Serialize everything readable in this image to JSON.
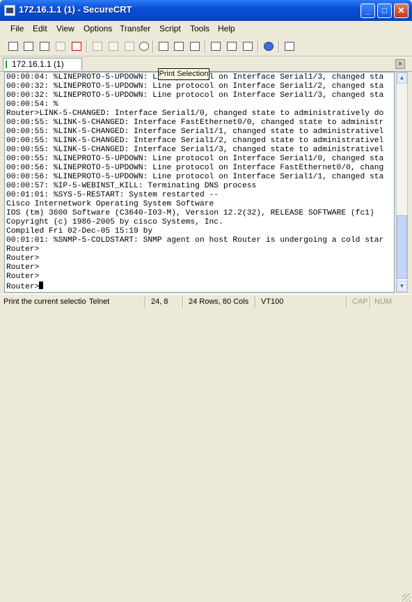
{
  "window": {
    "title": "172.16.1.1 (1) - SecureCRT"
  },
  "menu": [
    "File",
    "Edit",
    "View",
    "Options",
    "Transfer",
    "Script",
    "Tools",
    "Help"
  ],
  "toolbar": {
    "buttons": [
      "connect-icon",
      "quick-connect-icon",
      "connect-in-tab-icon",
      "reconnect-icon",
      "disconnect-icon",
      "copy-icon",
      "paste-icon",
      "copy-paste-icon",
      "find-icon",
      "print-selection-icon",
      "print-setup-icon",
      "print-icon",
      "session-options-icon",
      "global-options-icon",
      "keymap-icon",
      "help-icon",
      "customize-icon"
    ],
    "tooltip": "Print Selection"
  },
  "tab": {
    "label": "172.16.1.1 (1)",
    "close": "×"
  },
  "terminal": {
    "lines": [
      "00:00:04: %LINEPROTO-5-UPDOWN: Line protocol on Interface Serial1/3, changed sta",
      "00:00:32: %LINEPROTO-5-UPDOWN: Line protocol on Interface Serial1/2, changed sta",
      "00:00:32: %LINEPROTO-5-UPDOWN: Line protocol on Interface Serial1/3, changed sta",
      "00:00:54: %",
      "Router>LINK-5-CHANGED: Interface Serial1/0, changed state to administratively do",
      "00:00:55: %LINK-5-CHANGED: Interface FastEthernet0/0, changed state to administr",
      "00:00:55: %LINK-5-CHANGED: Interface Serial1/1, changed state to administrativel",
      "00:00:55: %LINK-5-CHANGED: Interface Serial1/2, changed state to administrativel",
      "00:00:55: %LINK-5-CHANGED: Interface Serial1/3, changed state to administrativel",
      "00:00:55: %LINEPROTO-5-UPDOWN: Line protocol on Interface Serial1/0, changed sta",
      "00:00:56: %LINEPROTO-5-UPDOWN: Line protocol on Interface FastEthernet0/0, chang",
      "00:00:56: %LINEPROTO-5-UPDOWN: Line protocol on Interface Serial1/1, changed sta",
      "00:00:57: %IP-5-WEBINST_KILL: Terminating DNS process",
      "00:01:01: %SYS-5-RESTART: System restarted --",
      "Cisco Internetwork Operating System Software",
      "IOS (tm) 3600 Software (C3640-I03-M), Version 12.2(32), RELEASE SOFTWARE (fc1)",
      "Copyright (c) 1986-2005 by cisco Systems, Inc.",
      "Compiled Fri 02-Dec-05 15:19 by",
      "00:01:01: %SNMP-5-COLDSTART: SNMP agent on host Router is undergoing a cold star",
      "Router>",
      "Router>",
      "Router>",
      "Router>",
      "Router>"
    ]
  },
  "status": {
    "message": "Print the current selectio",
    "protocol": "Telnet",
    "position": "24,  8",
    "size": "24 Rows, 80 Cols",
    "emulation": "VT100",
    "cap": "CAP",
    "num": "NUM"
  }
}
